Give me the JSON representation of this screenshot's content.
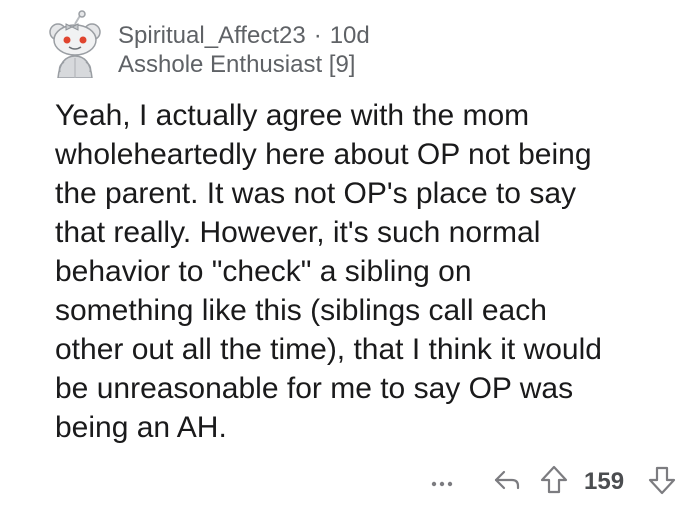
{
  "comment": {
    "username": "Spiritual_Affect23",
    "separator": "·",
    "age": "10d",
    "flair": "Asshole Enthusiast [9]",
    "body": "Yeah, I actually agree with the mom\nwholeheartedly here about OP not being\nthe parent. It was not OP's place to say\nthat really. However, it's such normal\nbehavior to \"check\" a sibling on\nsomething like this (siblings call each\nother out all the time), that I think it would\nbe unreasonable for me to say OP was\nbeing an AH.",
    "score": "159"
  },
  "icons": {
    "avatar": "snoo-avatar-icon",
    "more": "more-options-icon",
    "reply": "reply-arrow-icon",
    "upvote": "upvote-arrow-icon",
    "downvote": "downvote-arrow-icon"
  },
  "colors": {
    "meta_text": "#5f6266",
    "body_text": "#1a1a1b",
    "icon": "#7c7c80",
    "avatar_eye": "#e0452f"
  }
}
